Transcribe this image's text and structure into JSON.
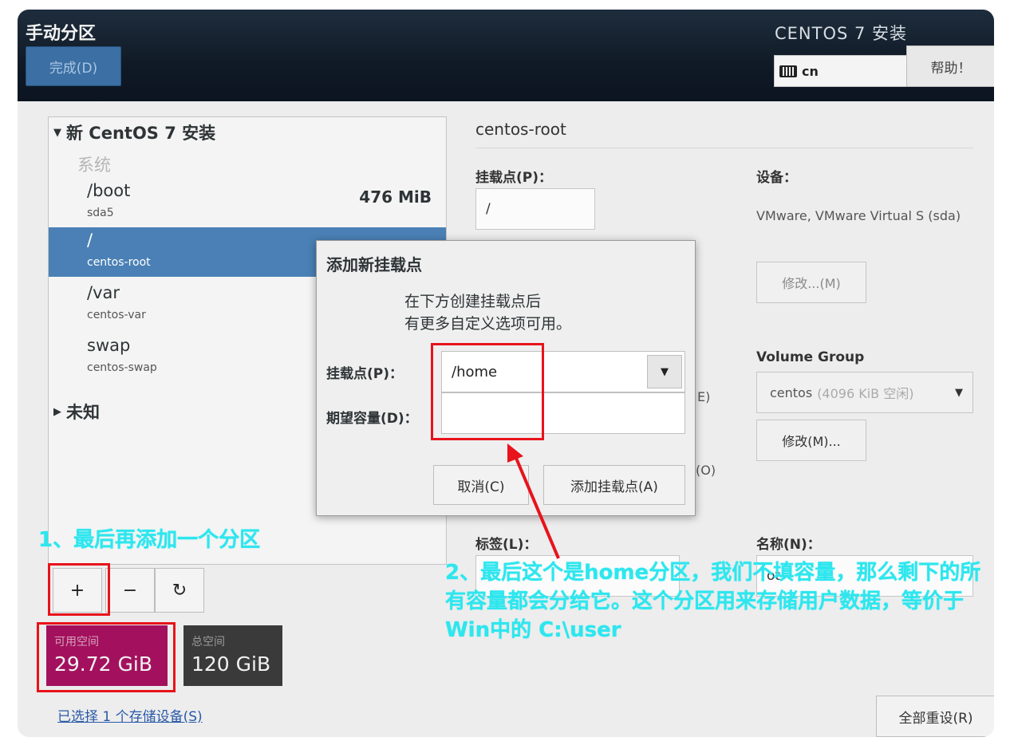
{
  "header": {
    "title": "手动分区",
    "done_label": "完成(D)",
    "product_title": "CENTOS 7 安装",
    "keyboard_layout": "cn",
    "help_label": "帮助！"
  },
  "left_panel": {
    "group_new": "新 CentOS 7 安装",
    "section_system": "系统",
    "partitions": [
      {
        "name": "/boot",
        "device": "sda5",
        "size": "476 MiB"
      },
      {
        "name": "/",
        "device": "centos-root",
        "size": ""
      },
      {
        "name": "/var",
        "device": "centos-var",
        "size": ""
      },
      {
        "name": "swap",
        "device": "centos-swap",
        "size": ""
      }
    ],
    "group_unknown": "未知",
    "toolbar": {
      "add": "+",
      "remove": "−",
      "refresh": "↻"
    },
    "available_space_label": "可用空间",
    "available_space_value": "29.72 GiB",
    "total_space_label": "总空间",
    "total_space_value": "120 GiB",
    "storage_link": "已选择 1 个存储设备(S)",
    "reset_label": "全部重设(R)"
  },
  "right_panel": {
    "title": "centos-root",
    "mount_point_label": "挂载点(P)：",
    "mount_point_value": "/",
    "device_label": "设备：",
    "device_value": "VMware, VMware Virtual S (sda)",
    "modify_label": "修改...(M)",
    "volume_group_label": "Volume Group",
    "volume_group_name": "centos",
    "volume_group_free": "(4096 KiB 空闲)",
    "modify_vg_label": "修改(M)...",
    "label_label": "标签(L)：",
    "name_label": "名称(N)：",
    "fragment_e": "E)",
    "fragment_o": "(O)",
    "fragment_name": "ot"
  },
  "dialog": {
    "title": "添加新挂载点",
    "description_line1": "在下方创建挂载点后",
    "description_line2": "有更多自定义选项可用。",
    "mount_point_label": "挂载点(P)：",
    "mount_point_value": "/home",
    "capacity_label": "期望容量(D)：",
    "capacity_value": "",
    "cancel_label": "取消(C)",
    "add_label": "添加挂载点(A)"
  },
  "annotations": {
    "note1": "1、最后再添加一个分区",
    "note2": "2、最后这个是home分区，我们不填容量，那么剩下的所有容量都会分给它。这个分区用来存储用户数据，等价于Win中的 C:\\user"
  },
  "colors": {
    "annotation": "#2ee6ee",
    "highlight_box": "#e8131b",
    "selection": "#4a80b5",
    "available_space": "#a3115e"
  }
}
